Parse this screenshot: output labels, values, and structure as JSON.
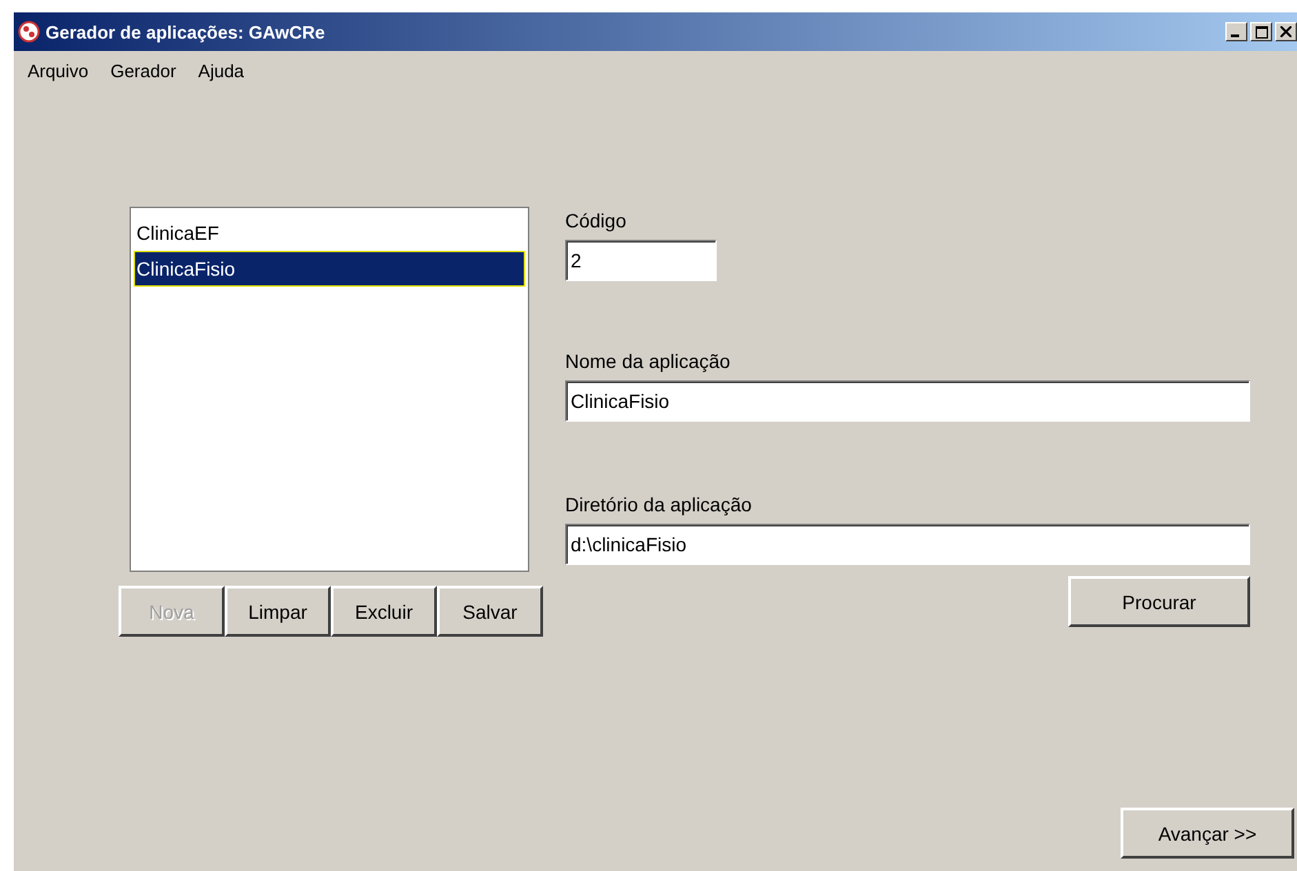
{
  "window": {
    "title": "Gerador de aplicações: GAwCRe"
  },
  "menu": [
    "Arquivo",
    "Gerador",
    "Ajuda"
  ],
  "list": {
    "items": [
      {
        "label": "ClinicaEF",
        "selected": false
      },
      {
        "label": "ClinicaFisio",
        "selected": true
      }
    ]
  },
  "list_buttons": [
    {
      "label": "Nova",
      "disabled": true
    },
    {
      "label": "Limpar",
      "disabled": false
    },
    {
      "label": "Excluir",
      "disabled": false
    },
    {
      "label": "Salvar",
      "disabled": false
    }
  ],
  "fields": [
    {
      "label": "Código",
      "value": "2",
      "kind": "short"
    },
    {
      "label": "Nome da aplicação",
      "value": "ClinicaFisio",
      "kind": "wide"
    },
    {
      "label": "Diretório da aplicação",
      "value": "d:\\clinicaFisio",
      "kind": "wide"
    }
  ],
  "browse_button": "Procurar",
  "next_button": "Avançar >>"
}
